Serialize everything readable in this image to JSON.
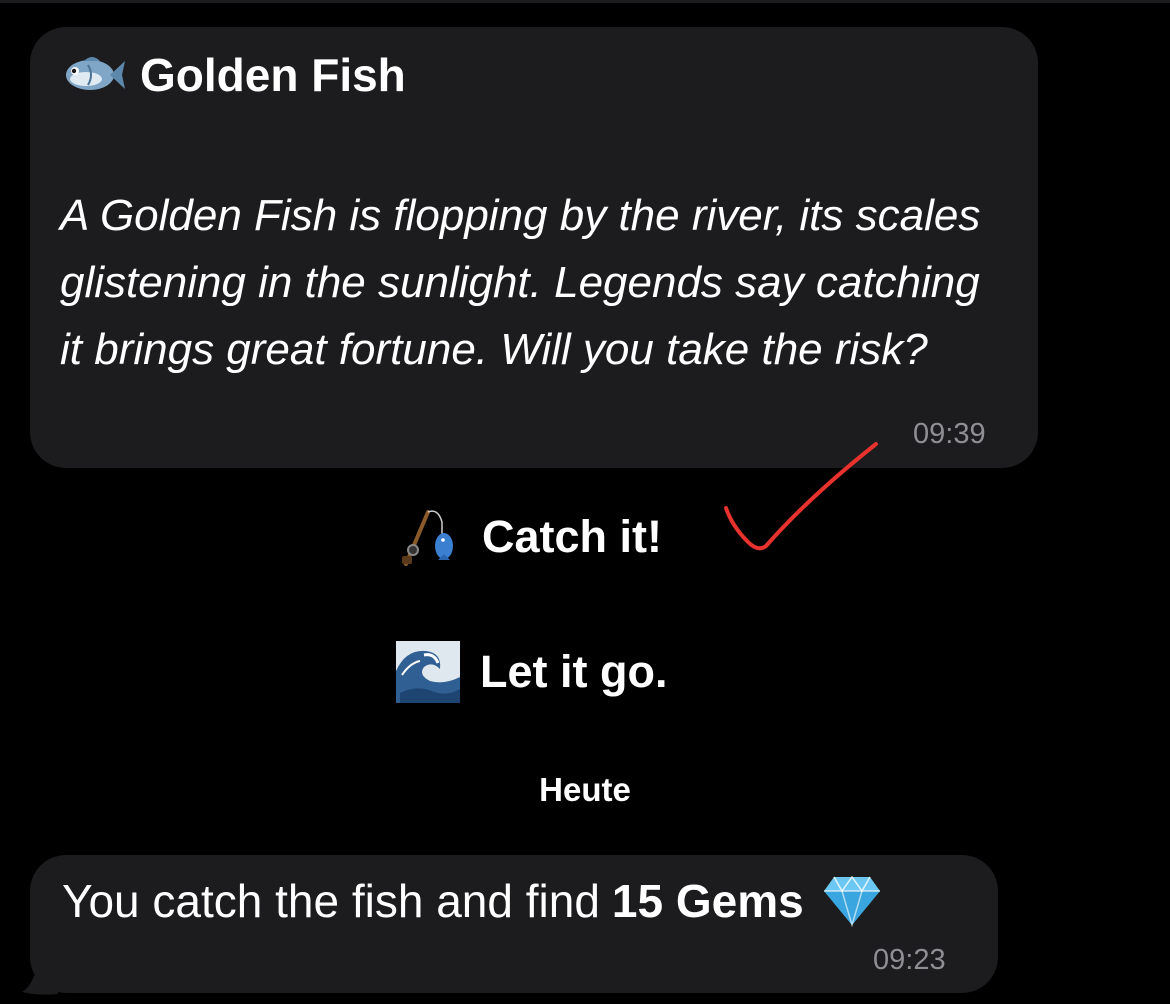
{
  "message_prompt": {
    "icon": "fish-icon",
    "title": "Golden Fish",
    "text": "A Golden Fish is flopping by the river, its scales glistening in the sunlight. Legends say catching it brings great fortune. Will you take the risk?",
    "time": "09:39"
  },
  "choices": [
    {
      "icon": "fishing-rod-icon",
      "label": "Catch it!",
      "marked": true
    },
    {
      "icon": "wave-icon",
      "label": "Let it go.",
      "marked": false
    }
  ],
  "date_separator": "Heute",
  "message_result": {
    "text_prefix": "You catch the fish and find",
    "reward": "15 Gems",
    "reward_icon": "gem-icon",
    "time": "09:23"
  },
  "colors": {
    "background": "#000000",
    "bubble": "#1c1c1e",
    "timestamp": "#8e8e93",
    "annotation_check": "#e8322e"
  }
}
